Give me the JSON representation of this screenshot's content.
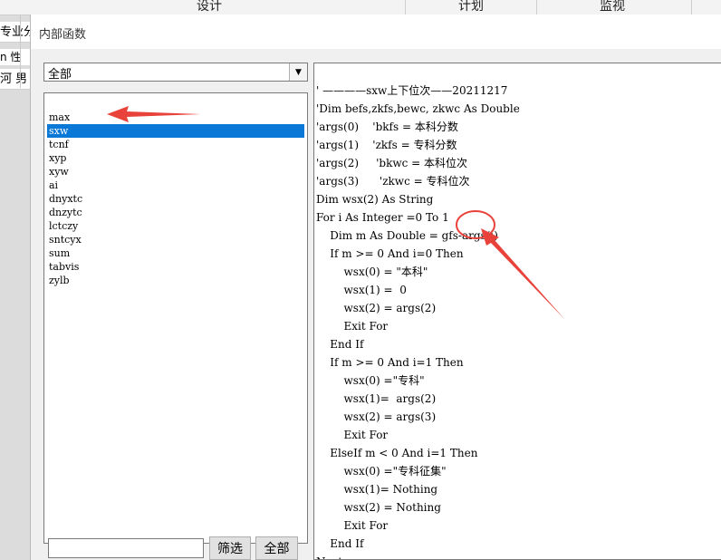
{
  "background_app": {
    "menu_tabs": [
      "设计",
      "计划",
      "监视"
    ],
    "left_fragments": [
      "专业分",
      "n  性",
      "河  男"
    ]
  },
  "dialog": {
    "title": "内部函数",
    "category_select": {
      "value": "全部"
    },
    "function_list": [
      "max",
      "sxw",
      "tcnf",
      "xyp",
      "xyw",
      "ai",
      "dnyxtc",
      "dnzytc",
      "lctczy",
      "sntcyx",
      "sum",
      "tabvis",
      "zylb"
    ],
    "selected_index": 1,
    "filter_input": {
      "value": "",
      "placeholder": ""
    },
    "filter_button": "筛选",
    "all_button": "全部",
    "code_lines": [
      "' ————sxw上下位次——20211217",
      "'Dim befs,zkfs,bewc, zkwc As Double",
      "'args(0)    'bkfs = 本科分数",
      "'args(1)    'zkfs = 专科分数",
      "'args(2)     'bkwc = 本科位次",
      "'args(3)      'zkwc = 专科位次",
      "Dim wsx(2) As String",
      "For i As Integer =0 To 1",
      "    Dim m As Double = gfs-args(i)",
      "    If m >= 0 And i=0 Then",
      "        wsx(0) = \"本科\"",
      "        wsx(1) =  0",
      "        wsx(2) = args(2)",
      "        Exit For",
      "    End If",
      "    If m >= 0 And i=1 Then",
      "        wsx(0) =\"专科\"",
      "        wsx(1)=  args(2)",
      "        wsx(2) = args(3)",
      "        Exit For",
      "    ElseIf m < 0 And i=1 Then",
      "        wsx(0) =\"专科征集\"",
      "        wsx(1)= Nothing",
      "        wsx(2) = Nothing",
      "        Exit For",
      "    End If",
      "Next"
    ]
  },
  "annotation_color": "#e8423a"
}
